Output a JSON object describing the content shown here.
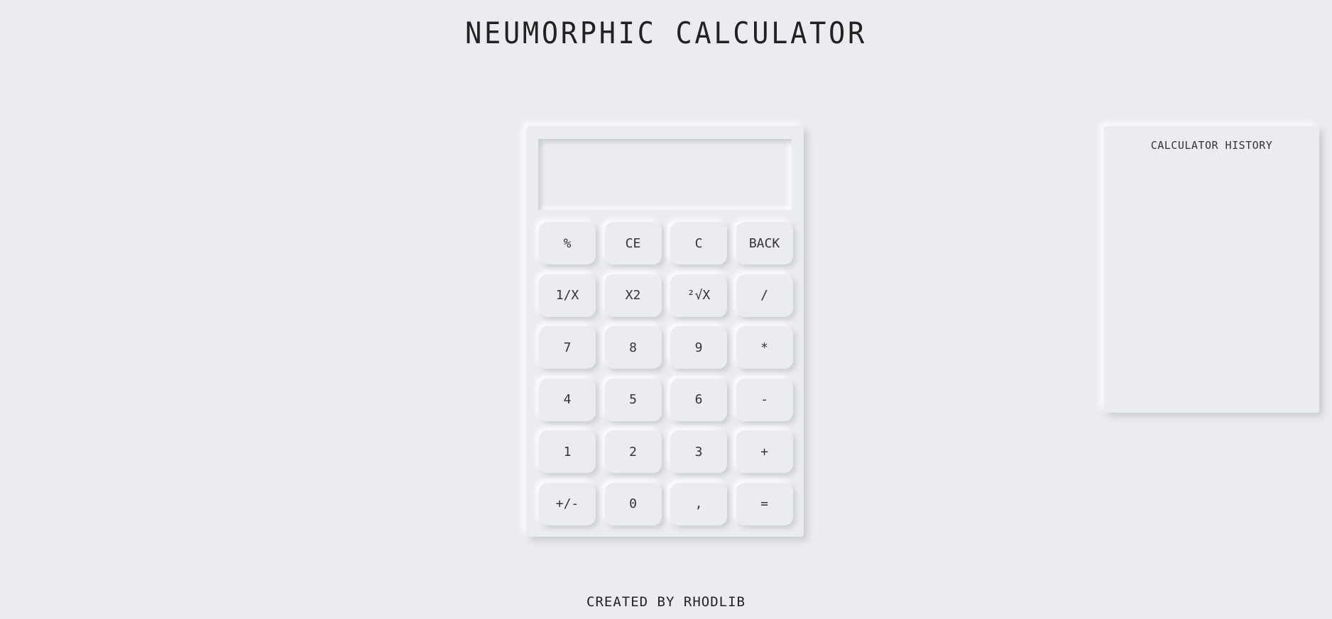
{
  "app": {
    "title": "NEUMORPHIC CALCULATOR",
    "footer": "CREATED BY RHODLIB"
  },
  "calculator": {
    "display_value": "",
    "keys": [
      {
        "label": "%",
        "name": "percent-key"
      },
      {
        "label": "CE",
        "name": "clear-entry-key"
      },
      {
        "label": "C",
        "name": "clear-key"
      },
      {
        "label": "BACK",
        "name": "backspace-key"
      },
      {
        "label": "1/X",
        "name": "reciprocal-key"
      },
      {
        "label": "X2",
        "name": "square-key"
      },
      {
        "label": "²√X",
        "name": "square-root-key"
      },
      {
        "label": "/",
        "name": "divide-key"
      },
      {
        "label": "7",
        "name": "digit-7-key"
      },
      {
        "label": "8",
        "name": "digit-8-key"
      },
      {
        "label": "9",
        "name": "digit-9-key"
      },
      {
        "label": "*",
        "name": "multiply-key"
      },
      {
        "label": "4",
        "name": "digit-4-key"
      },
      {
        "label": "5",
        "name": "digit-5-key"
      },
      {
        "label": "6",
        "name": "digit-6-key"
      },
      {
        "label": "-",
        "name": "subtract-key"
      },
      {
        "label": "1",
        "name": "digit-1-key"
      },
      {
        "label": "2",
        "name": "digit-2-key"
      },
      {
        "label": "3",
        "name": "digit-3-key"
      },
      {
        "label": "+",
        "name": "add-key"
      },
      {
        "label": "+/-",
        "name": "negate-key"
      },
      {
        "label": "0",
        "name": "digit-0-key"
      },
      {
        "label": ",",
        "name": "decimal-key"
      },
      {
        "label": "=",
        "name": "equals-key"
      }
    ]
  },
  "history": {
    "title": "CALCULATOR HISTORY",
    "entries": []
  },
  "colors": {
    "background": "#ebecf0",
    "text": "#2b2b2b",
    "shadow_dark": "#c8cad2",
    "shadow_light": "#ffffff"
  }
}
